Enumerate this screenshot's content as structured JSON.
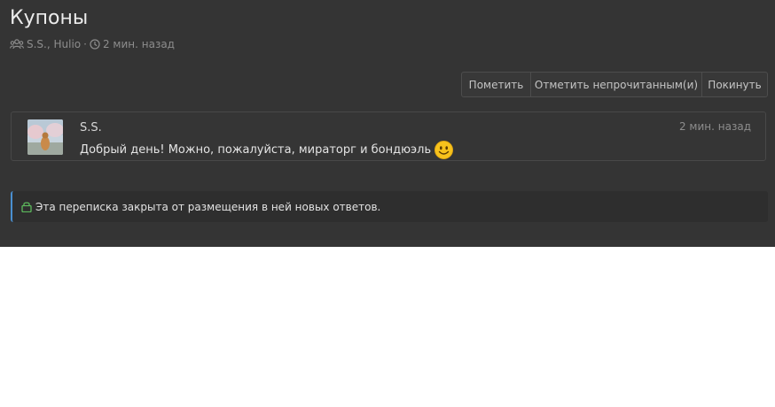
{
  "thread": {
    "title": "Купоны",
    "participants": "S.S., Hulio",
    "separator": "·",
    "age": "2 мин. назад"
  },
  "actions": {
    "mark_label": "Пометить",
    "mark_unread_label": "Отметить непрочитанным(и)",
    "leave_label": "Покинуть"
  },
  "message": {
    "author": "S.S.",
    "time": "2 мин. назад",
    "text": "Добрый день! Можно, пожалуйста, мираторг и бондюэль"
  },
  "notice": {
    "text": "Эта переписка закрыта от размещения в ней новых ответов."
  },
  "icons": {
    "participants": "users-icon",
    "time": "clock-icon",
    "smiley": "smiley-emoji",
    "lock": "lock-icon"
  },
  "colors": {
    "panel_bg": "#343434",
    "accent": "#4a8fd0",
    "lock": "#5cb85c"
  }
}
